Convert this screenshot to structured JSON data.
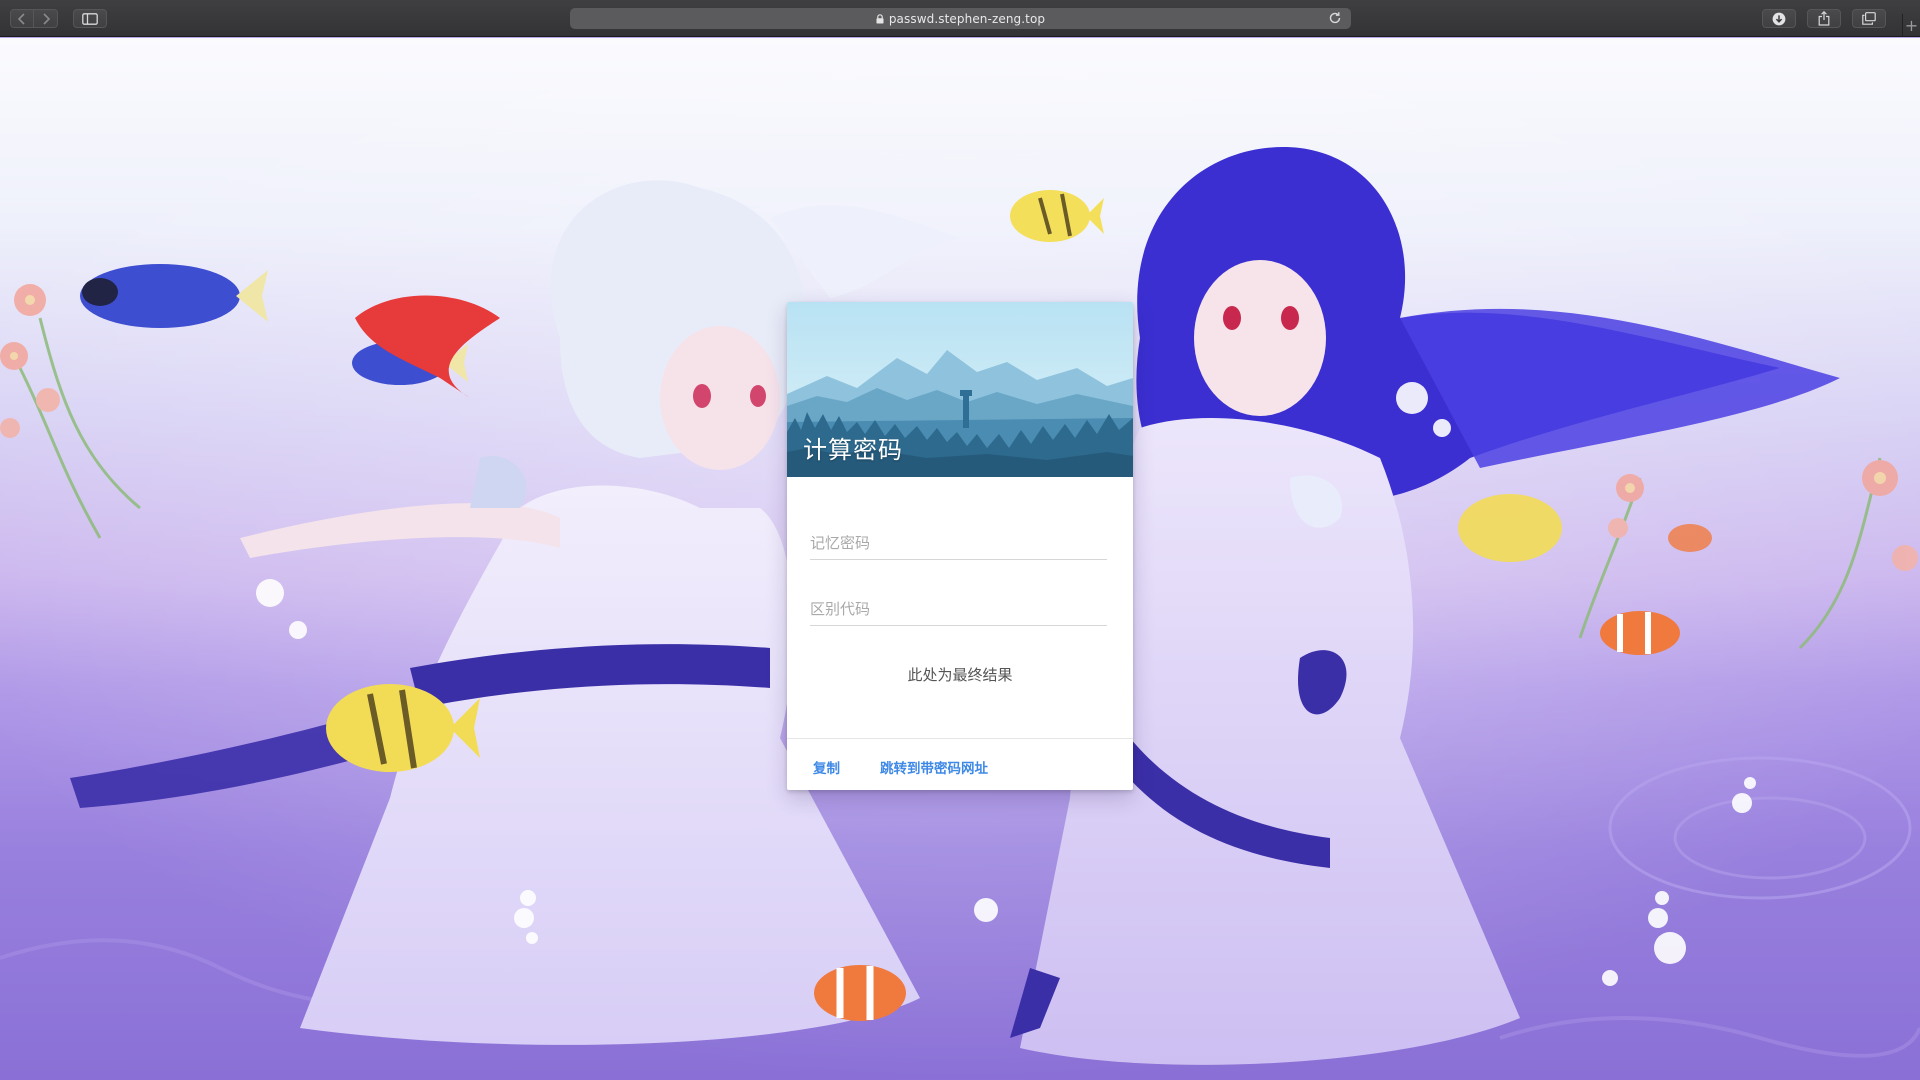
{
  "browser": {
    "url": "passwd.stephen-zeng.top",
    "icons": [
      "chevron-left-icon",
      "chevron-right-icon",
      "sidebar-icon",
      "lock-icon",
      "reload-icon",
      "download-icon",
      "share-icon",
      "tabs-icon",
      "plus-icon"
    ],
    "new_tab_label": "+"
  },
  "card": {
    "title": "计算密码",
    "memory_password_placeholder": "记忆密码",
    "distinguish_code_placeholder": "区别代码",
    "result_text": "此处为最终结果",
    "actions": {
      "copy_label": "复制",
      "jump_label": "跳转到带密码网址"
    },
    "accent_color": "#3f89e6"
  }
}
